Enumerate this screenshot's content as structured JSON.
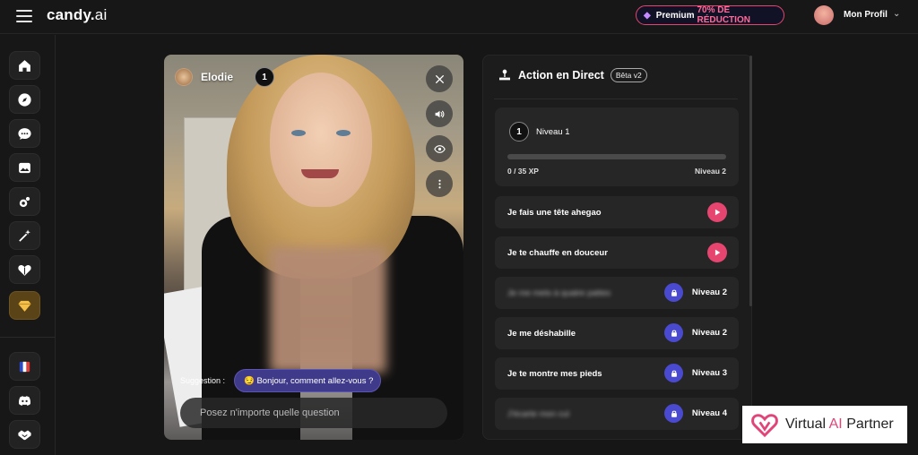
{
  "header": {
    "logo_main": "candy.",
    "logo_accent": "ai",
    "premium_prefix": "Premium",
    "premium_discount": "70% DE RÉDUCTION",
    "profile_label": "Mon Profil"
  },
  "sidebar": {
    "items": [
      {
        "name": "home",
        "icon": "home-icon"
      },
      {
        "name": "explore",
        "icon": "compass-icon"
      },
      {
        "name": "chat",
        "icon": "chat-bubble-icon"
      },
      {
        "name": "gallery",
        "icon": "image-icon"
      },
      {
        "name": "create",
        "icon": "sparkle-magic-icon"
      },
      {
        "name": "generate",
        "icon": "magic-wand-icon"
      },
      {
        "name": "my-ai",
        "icon": "heart-icon"
      },
      {
        "name": "premium",
        "icon": "diamond-icon"
      },
      {
        "name": "language",
        "icon": "france-flag-icon"
      },
      {
        "name": "discord",
        "icon": "discord-icon"
      },
      {
        "name": "affiliate",
        "icon": "handshake-icon"
      }
    ]
  },
  "video": {
    "character_name": "Elodie",
    "level": "1",
    "suggestion_label": "Suggestion :",
    "suggestion_text": "😏 Bonjour, comment allez-vous ?",
    "input_placeholder": "Posez n'importe quelle question"
  },
  "panel": {
    "title": "Action en Direct",
    "beta": "Bêta v2",
    "level": {
      "badge": "1",
      "name": "Niveau 1",
      "xp": "0 / 35 XP",
      "next": "Niveau 2",
      "progress": 0
    },
    "actions": [
      {
        "label": "Je fais une tête ahegao",
        "state": "play",
        "requirement": ""
      },
      {
        "label": "Je te chauffe en douceur",
        "state": "play",
        "requirement": ""
      },
      {
        "label": "Je me mets à quatre pattes",
        "state": "locked",
        "requirement": "Niveau 2",
        "blurred": true
      },
      {
        "label": "Je me déshabille",
        "state": "locked",
        "requirement": "Niveau 2"
      },
      {
        "label": "Je te montre mes pieds",
        "state": "locked",
        "requirement": "Niveau 3"
      },
      {
        "label": "J'écarte mon cul",
        "state": "locked",
        "requirement": "Niveau 4",
        "blurred": true
      }
    ]
  },
  "watermark": {
    "text_start": "Virtual ",
    "text_ai": "AI",
    "text_end": " Partner"
  },
  "colors": {
    "accent_pink": "#e5456f",
    "lock_purple": "#4a4ad0",
    "background": "#161616"
  }
}
